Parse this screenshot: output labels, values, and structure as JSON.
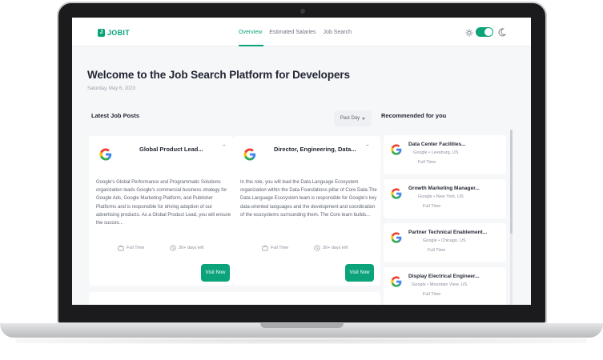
{
  "app": {
    "logo_text": "JOBIT",
    "logo_mark": "J"
  },
  "nav": {
    "links": [
      "Overview",
      "Estimated Salaries",
      "Job Search"
    ],
    "active": "Overview",
    "theme_toggle": "on"
  },
  "page": {
    "title": "Welcome to the Job Search Platform for Developers",
    "date": "Saturday, May 6, 2023"
  },
  "latest": {
    "heading": "Latest Job Posts",
    "filter_label": "Past Day",
    "jobs": [
      {
        "title": "Global Product Lead...",
        "description": "Google's Global Performance and Programmatic Solutions organization leads Google's commercial business strategy for Google Ads, Google Marketing Platform, and Publisher Platforms and is responsible for driving adoption of our advertising products. As a Global Product Lead, you will ensure the succes...",
        "type": "Full Time",
        "posted": "30+ days left",
        "action": "Visit Now",
        "menu": "..."
      },
      {
        "title": "Director, Engineering, Data...",
        "description": "In this role, you will lead the Data Language Ecosystem organization within the Data Foundations pillar of Core Data.The Data Language Ecosystem team is responsible for Google's key data-oriented languages and the development and coordination of the ecosystems surrounding them. The Core team builds...",
        "type": "Full Time",
        "posted": "30+ days left",
        "action": "Visit Now",
        "menu": "..."
      }
    ]
  },
  "recommended": {
    "heading": "Recommended for you",
    "items": [
      {
        "title": "Data Center Facilities...",
        "company": "Google",
        "location": "Leesburg, US",
        "type": "Full Time"
      },
      {
        "title": "Growth Marketing Manager...",
        "company": "Google",
        "location": "New York, US",
        "type": "Full Time"
      },
      {
        "title": "Partner Technical Enablement...",
        "company": "Google",
        "location": "Chicago, US",
        "type": "Full Time"
      },
      {
        "title": "Display Electrical Engineer...",
        "company": "Google",
        "location": "Mountain View, US",
        "type": "Full Time"
      }
    ],
    "separator": "•"
  },
  "colors": {
    "accent": "#0aa37a",
    "background": "#f6f7f9",
    "text": "#1f2430"
  }
}
